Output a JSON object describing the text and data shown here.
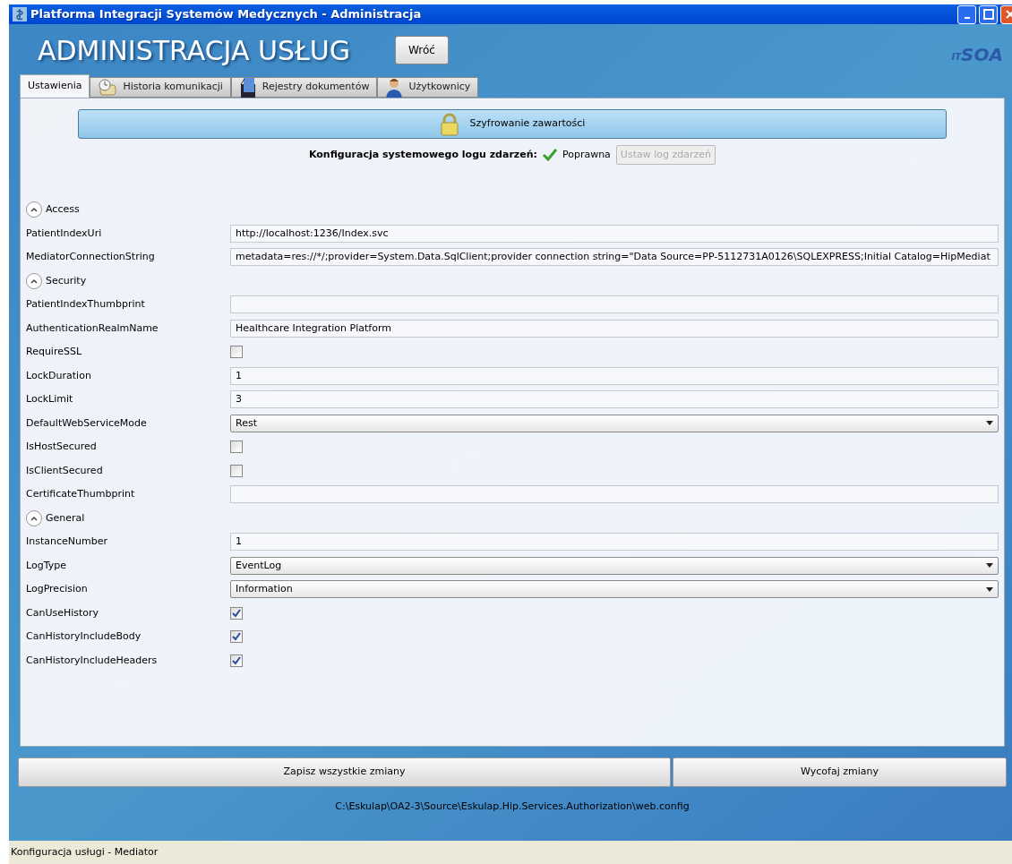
{
  "window": {
    "title": "Platforma Integracji Systemów Medycznych - Administracja"
  },
  "header": {
    "title": "ADMINISTRACJA USŁUG",
    "back_button": "Wróć",
    "logo_prefix": "IT",
    "logo_text": "SOA"
  },
  "tabs": [
    {
      "label": "Ustawienia",
      "selected": true
    },
    {
      "label": "Historia komunikacji",
      "selected": false
    },
    {
      "label": "Rejestry dokumentów",
      "selected": false
    },
    {
      "label": "Użytkownicy",
      "selected": false
    }
  ],
  "encryption_button": "Szyfrowanie zawartości",
  "event_log": {
    "label": "Konfiguracja systemowego logu zdarzeń:",
    "status": "Poprawna",
    "ok": true,
    "button": "Ustaw log zdarzeń",
    "button_disabled": true
  },
  "sections": [
    {
      "title": "Access",
      "expanded": true,
      "properties": [
        {
          "name": "PatientIndexUri",
          "kind": "text",
          "value": "http://localhost:1236/Index.svc"
        },
        {
          "name": "MediatorConnectionString",
          "kind": "text",
          "value": "metadata=res://*/;provider=System.Data.SqlClient;provider connection string=\"Data Source=PP-5112731A0126\\SQLEXPRESS;Initial Catalog=HipMediat"
        }
      ]
    },
    {
      "title": "Security",
      "expanded": true,
      "properties": [
        {
          "name": "PatientIndexThumbprint",
          "kind": "text"
        },
        {
          "name": "AuthenticationRealmName",
          "kind": "text",
          "value": "Healthcare Integration Platform"
        },
        {
          "name": "RequireSSL",
          "kind": "checkbox",
          "checked": false
        },
        {
          "name": "LockDuration",
          "kind": "text",
          "value": "1"
        },
        {
          "name": "LockLimit",
          "kind": "text",
          "value": "3"
        },
        {
          "name": "DefaultWebServiceMode",
          "kind": "dropdown",
          "value": "Rest"
        },
        {
          "name": "IsHostSecured",
          "kind": "checkbox",
          "checked": false
        },
        {
          "name": "IsClientSecured",
          "kind": "checkbox",
          "checked": false
        },
        {
          "name": "CertificateThumbprint",
          "kind": "text"
        }
      ]
    },
    {
      "title": "General",
      "expanded": true,
      "properties": [
        {
          "name": "InstanceNumber",
          "kind": "text",
          "value": "1"
        },
        {
          "name": "LogType",
          "kind": "dropdown",
          "value": "EventLog"
        },
        {
          "name": "LogPrecision",
          "kind": "dropdown",
          "value": "Information"
        },
        {
          "name": "CanUseHistory",
          "kind": "checkbox",
          "checked": true
        },
        {
          "name": "CanHistoryIncludeBody",
          "kind": "checkbox",
          "checked": true
        },
        {
          "name": "CanHistoryIncludeHeaders",
          "kind": "checkbox",
          "checked": true
        }
      ]
    }
  ],
  "buttons": [
    "Zapisz wszystkie zmiany",
    "Wycofaj zmiany"
  ],
  "config_path": "C:\\Eskulap\\OA2-3\\Source\\Eskulap.Hip.Services.Authorization\\web.config",
  "status_bar": "Konfiguracja usługi - Mediator"
}
